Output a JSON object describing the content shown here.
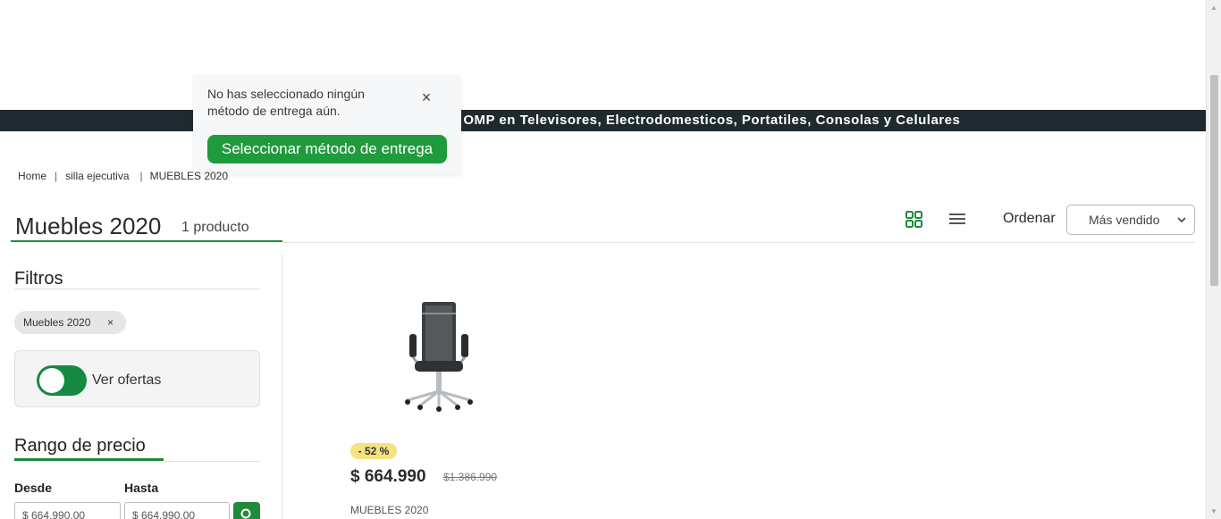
{
  "promo_bar": {
    "text": "n OMP en Televisores, Electrodomesticos, Portatiles, Consolas y Celulares"
  },
  "delivery_popup": {
    "message": "No has seleccionado ningún método de entrega aún.",
    "close_icon": "×",
    "button_label": "Seleccionar método de entrega"
  },
  "breadcrumb": {
    "items": [
      "Home",
      "silla ejecutiva",
      "MUEBLES 2020"
    ],
    "separator": "|"
  },
  "header": {
    "title": "Muebles 2020",
    "count": "1 producto",
    "order_label": "Ordenar",
    "order_selected": "Más vendido",
    "accent_color": "#1f8a3a"
  },
  "sidebar": {
    "filters_title": "Filtros",
    "active_filter": {
      "label": "Muebles 2020",
      "remove": "×"
    },
    "offers_toggle": {
      "label": "Ver ofertas",
      "on": true
    },
    "price_range": {
      "title": "Rango de precio",
      "from_label": "Desde",
      "to_label": "Hasta",
      "from_value": "$ 664.990,00",
      "to_value": "$ 664.990,00"
    }
  },
  "product": {
    "discount": "- 52 %",
    "price": "$ 664.990",
    "old_price": "$1.386.990",
    "brand": "MUEBLES 2020",
    "image_icon": "office-chair"
  },
  "icons": {
    "grid": "grid-view-icon",
    "list": "list-view-icon",
    "chevron": "chevron-down-icon",
    "search": "search-icon"
  }
}
